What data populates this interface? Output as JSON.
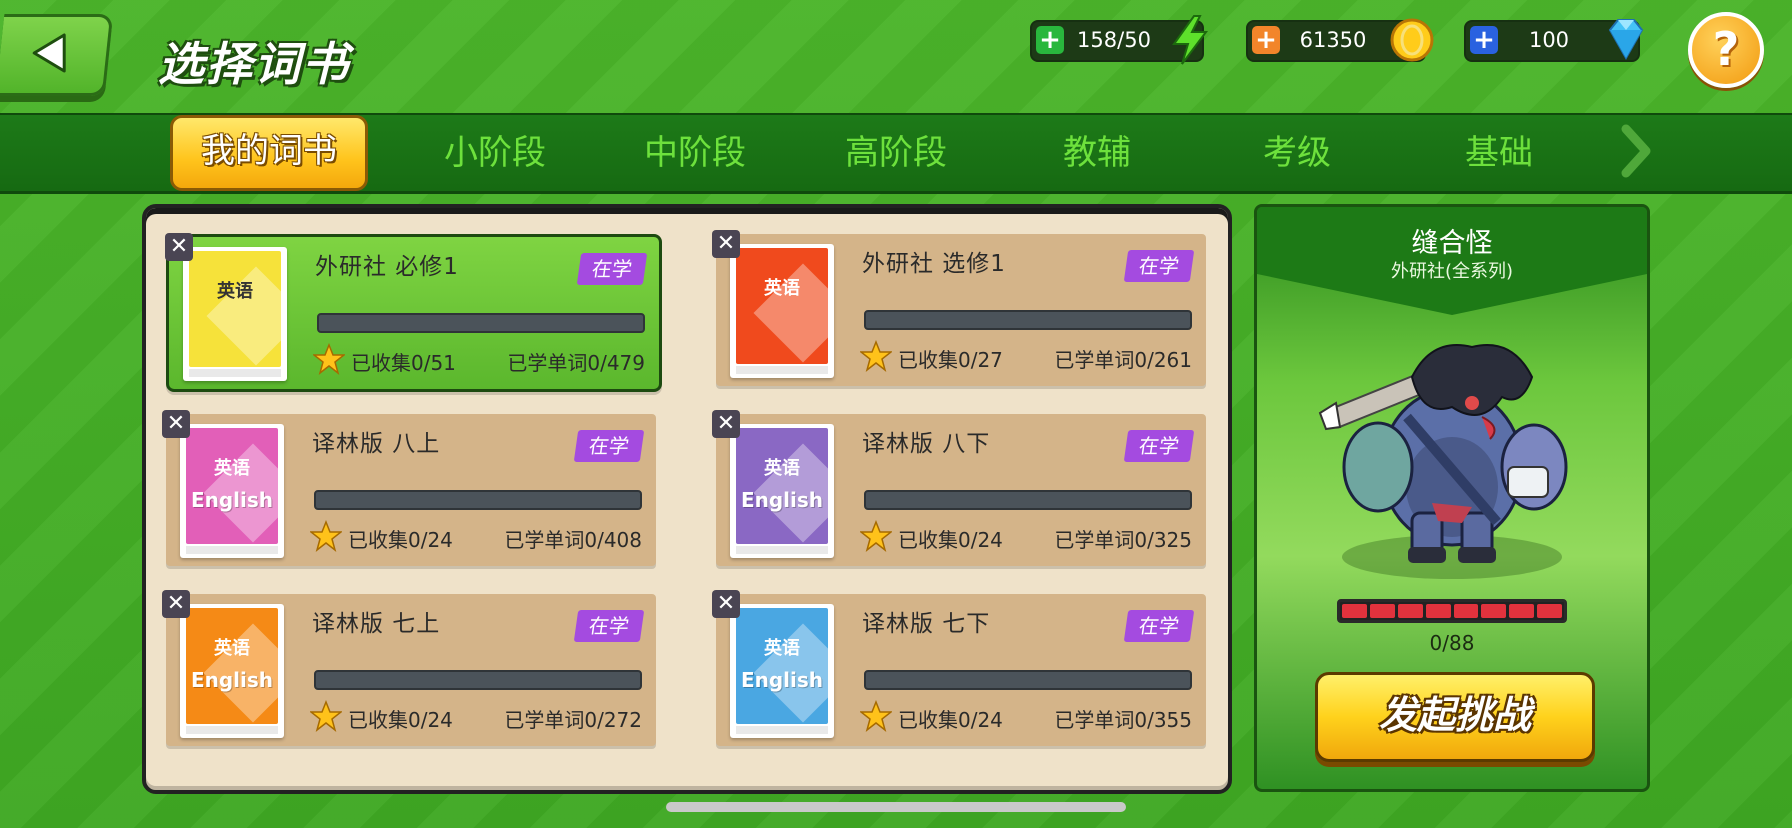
{
  "header": {
    "title": "选择词书",
    "energy": "158/50",
    "coins": "61350",
    "gems": "100",
    "help_label": "?"
  },
  "tabs": [
    {
      "label": "我的词书",
      "active": true
    },
    {
      "label": "小阶段"
    },
    {
      "label": "中阶段"
    },
    {
      "label": "高阶段"
    },
    {
      "label": "教辅"
    },
    {
      "label": "考级"
    },
    {
      "label": "基础"
    }
  ],
  "books": [
    {
      "title": "外研社  必修1",
      "status": "在学",
      "collected": "已收集0/51",
      "learned": "已学单词0/479",
      "progress": 0,
      "cover_color": "#f6e23a",
      "cover_cn": "英语",
      "cover_en": "",
      "selected": true
    },
    {
      "title": "外研社  选修1",
      "status": "在学",
      "collected": "已收集0/27",
      "learned": "已学单词0/261",
      "progress": 0,
      "cover_color": "#f04a1d",
      "cover_cn": "英语",
      "cover_en": "",
      "selected": false
    },
    {
      "title": "译林版  八上",
      "status": "在学",
      "collected": "已收集0/24",
      "learned": "已学单词0/408",
      "progress": 0,
      "cover_color": "#e25fb8",
      "cover_cn": "英语",
      "cover_en": "English",
      "selected": false
    },
    {
      "title": "译林版  八下",
      "status": "在学",
      "collected": "已收集0/24",
      "learned": "已学单词0/325",
      "progress": 0,
      "cover_color": "#8a68c4",
      "cover_cn": "英语",
      "cover_en": "English",
      "selected": false
    },
    {
      "title": "译林版  七上",
      "status": "在学",
      "collected": "已收集0/24",
      "learned": "已学单词0/272",
      "progress": 0,
      "cover_color": "#f58a16",
      "cover_cn": "英语",
      "cover_en": "English",
      "selected": false
    },
    {
      "title": "译林版  七下",
      "status": "在学",
      "collected": "已收集0/24",
      "learned": "已学单词0/355",
      "progress": 0,
      "cover_color": "#4aa7e2",
      "cover_cn": "英语",
      "cover_en": "English",
      "selected": false
    }
  ],
  "boss": {
    "name": "缝合怪",
    "subtitle": "外研社(全系列)",
    "hp": "0/88",
    "challenge_label": "发起挑战"
  },
  "colors": {
    "background": "#45ae27",
    "tab_active": "#ffc41c",
    "status_tag": "#a44be0",
    "hp": "#e2323d"
  }
}
